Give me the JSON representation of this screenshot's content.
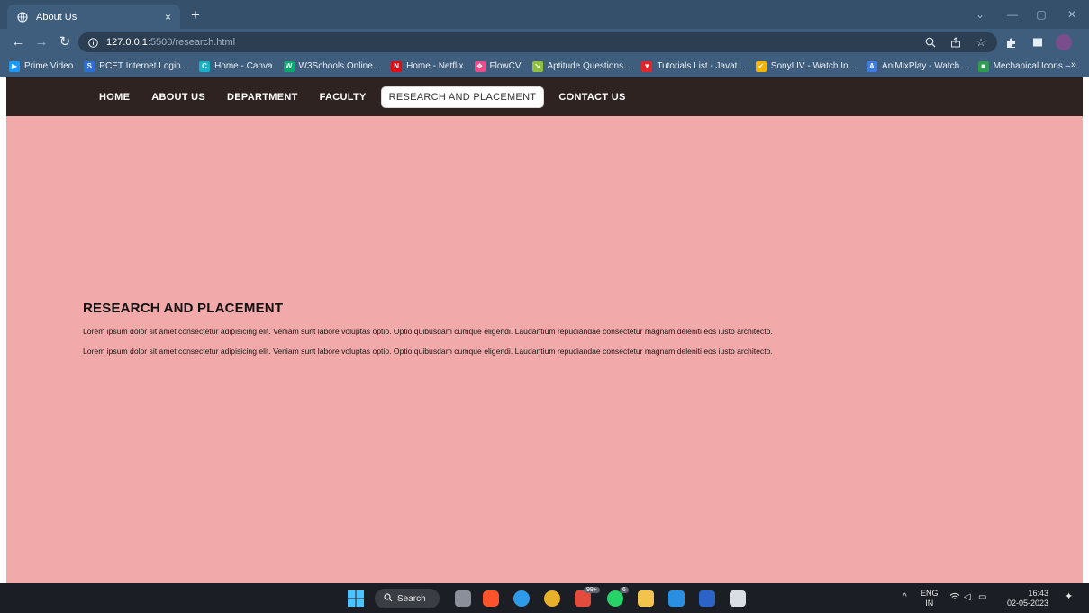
{
  "browser": {
    "tab_title": "About Us",
    "tab_close": "×",
    "new_tab": "+",
    "url_host": "127.0.0.1",
    "url_path": ":5500/research.html",
    "bookmarks": [
      {
        "label": "Prime Video",
        "color": "#1a98ff",
        "glyph": "▶"
      },
      {
        "label": "PCET Internet Login...",
        "color": "#2b6fd6",
        "glyph": "S"
      },
      {
        "label": "Home - Canva",
        "color": "#16b1c4",
        "glyph": "C"
      },
      {
        "label": "W3Schools Online...",
        "color": "#04aa6d",
        "glyph": "W"
      },
      {
        "label": "Home - Netflix",
        "color": "#e50914",
        "glyph": "N"
      },
      {
        "label": "FlowCV",
        "color": "#e94d8b",
        "glyph": "❖"
      },
      {
        "label": "Aptitude Questions...",
        "color": "#8fbf3f",
        "glyph": "↘"
      },
      {
        "label": "Tutorials List - Javat...",
        "color": "#e3252b",
        "glyph": "▼"
      },
      {
        "label": "SonyLIV - Watch In...",
        "color": "#f2b400",
        "glyph": "✔"
      },
      {
        "label": "AniMixPlay - Watch...",
        "color": "#3d7be0",
        "glyph": "A"
      },
      {
        "label": "Mechanical Icons –...",
        "color": "#2e9e4e",
        "glyph": "■"
      }
    ],
    "bookmarks_more": "»"
  },
  "site": {
    "nav": [
      "HOME",
      "ABOUT US",
      "DEPARTMENT",
      "FACULTY",
      "RESEARCH AND PLACEMENT",
      "CONTACT US"
    ],
    "active_index": 4,
    "heading": "RESEARCH AND PLACEMENT",
    "paragraphs": [
      "Lorem ipsum dolor sit amet consectetur adipisicing elit. Veniam sunt labore voluptas optio. Optio quibusdam cumque eligendi. Laudantium repudiandae consectetur magnam deleniti eos iusto architecto.",
      "Lorem ipsum dolor sit amet consectetur adipisicing elit. Veniam sunt labore voluptas optio. Optio quibusdam cumque eligendi. Laudantium repudiandae consectetur magnam deleniti eos iusto architecto."
    ]
  },
  "taskbar": {
    "search_label": "Search",
    "lang_top": "ENG",
    "lang_bottom": "IN",
    "time": "16:43",
    "date": "02-05-2023",
    "badge_mail": "99+",
    "badge_whatsapp": "6"
  },
  "colors": {
    "page_bg": "#f2a9a9",
    "nav_bg": "#2e2320",
    "chrome": "#3f5d7c"
  }
}
